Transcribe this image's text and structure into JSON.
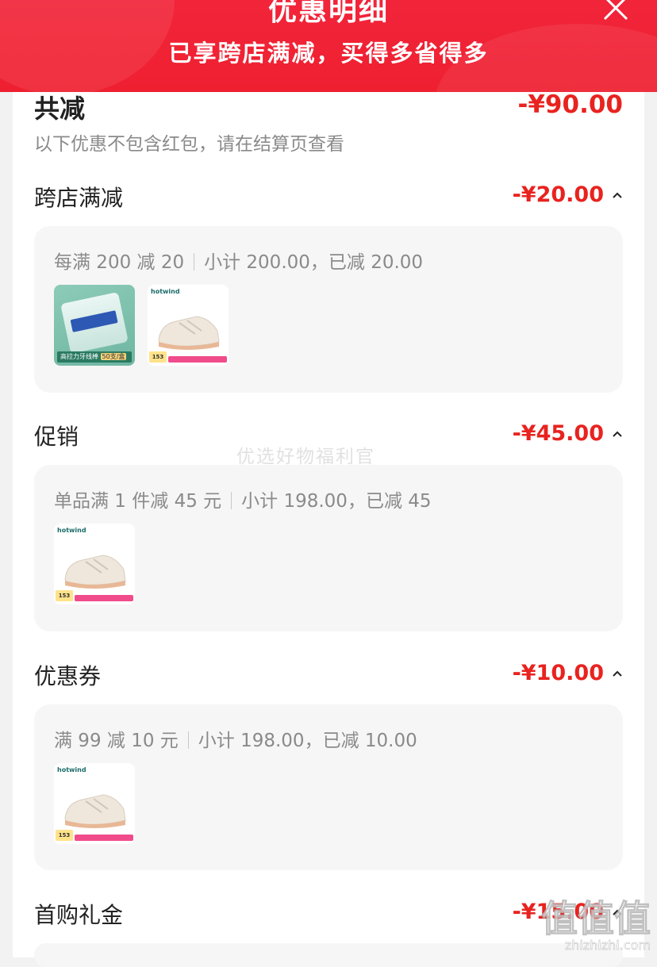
{
  "header": {
    "title": "优惠明细",
    "subtitle": "已享跨店满减，买得多省得多"
  },
  "summary": {
    "label": "共减",
    "amount": "-¥90.00",
    "note": "以下优惠不包含红包，请在结算页查看"
  },
  "sections": [
    {
      "title": "跨店满减",
      "amount": "-¥20.00",
      "rule": "每满 200 减 20",
      "detail": "小计 200.00，已减 20.00",
      "products": [
        {
          "type": "floss",
          "label": "高拉力牙线棒",
          "badge": "50支/盒"
        },
        {
          "type": "shoe",
          "brand": "hotwind",
          "price": "153"
        }
      ]
    },
    {
      "title": "促销",
      "amount": "-¥45.00",
      "rule": "单品满 1 件减 45 元",
      "detail": "小计 198.00，已减 45",
      "products": [
        {
          "type": "shoe",
          "brand": "hotwind",
          "price": "153"
        }
      ]
    },
    {
      "title": "优惠券",
      "amount": "-¥10.00",
      "rule": "满 99 减 10 元",
      "detail": "小计 198.00，已减 10.00",
      "products": [
        {
          "type": "shoe",
          "brand": "hotwind",
          "price": "153"
        }
      ]
    },
    {
      "title": "首购礼金",
      "amount": "-¥15.00"
    }
  ],
  "watermarks": {
    "center": "优选好物福利官",
    "site_big": "值值值",
    "site_small": "zhizhizhi.com"
  },
  "colors": {
    "header_red": "#f2243a",
    "amount_red": "#e8231f",
    "card_bg": "#f6f6f6"
  }
}
